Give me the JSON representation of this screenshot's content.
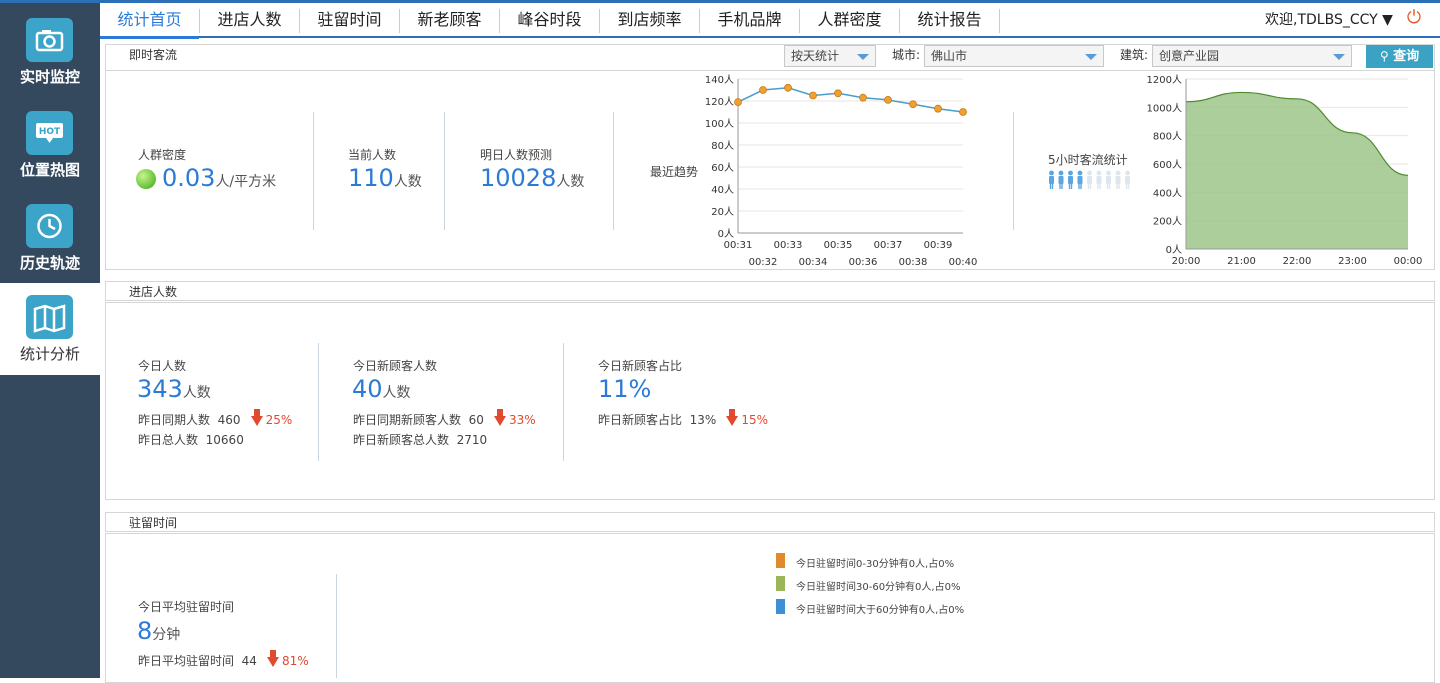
{
  "sidebar": {
    "items": [
      {
        "label": "实时监控"
      },
      {
        "label": "位置热图",
        "icon_text": "HOT"
      },
      {
        "label": "历史轨迹"
      },
      {
        "label": "统计分析"
      }
    ]
  },
  "tabs": [
    "统计首页",
    "进店人数",
    "驻留时间",
    "新老顾客",
    "峰谷时段",
    "到店频率",
    "手机品牌",
    "人群密度",
    "统计报告"
  ],
  "header": {
    "welcome": "欢迎,TDLBS_CCY ▼"
  },
  "instant": {
    "title": "即时客流",
    "stat_mode": "按天统计",
    "city_label": "城市:",
    "city": "佛山市",
    "building_label": "建筑:",
    "building": "创意产业园",
    "query": "查询",
    "density_label": "人群密度",
    "density_value": "0.03",
    "density_unit": "人/平方米",
    "current_label": "当前人数",
    "current_value": "110",
    "current_unit": "人数",
    "forecast_label": "明日人数预测",
    "forecast_value": "10028",
    "forecast_unit": "人数",
    "trend_label": "最近趋势",
    "five_hour_label": "5小时客流统计"
  },
  "store": {
    "title": "进店人数",
    "today_label": "今日人数",
    "today_value": "343",
    "today_unit": "人数",
    "yday_same_label": "昨日同期人数",
    "yday_same_value": "460",
    "yday_same_pct": "25%",
    "yday_total_label": "昨日总人数",
    "yday_total_value": "10660",
    "new_label": "今日新顾客人数",
    "new_value": "40",
    "new_unit": "人数",
    "yday_new_same_label": "昨日同期新顾客人数",
    "yday_new_same_value": "60",
    "yday_new_same_pct": "33%",
    "yday_new_total_label": "昨日新顾客总人数",
    "yday_new_total_value": "2710",
    "ratio_label": "今日新顾客占比",
    "ratio_value": "11%",
    "yday_ratio_label": "昨日新顾客占比",
    "yday_ratio_value": "13%",
    "yday_ratio_pct": "15%"
  },
  "dwell": {
    "title": "驻留时间",
    "avg_label": "今日平均驻留时间",
    "avg_value": "8",
    "avg_unit": "分钟",
    "yday_label": "昨日平均驻留时间",
    "yday_value": "44",
    "yday_pct": "81%",
    "legend": [
      {
        "text": "今日驻留时间0-30分钟有0人,占0%",
        "color": "#e08a2c"
      },
      {
        "text": "今日驻留时间30-60分钟有0人,占0%",
        "color": "#9bb55a"
      },
      {
        "text": "今日驻留时间大于60分钟有0人,占0%",
        "color": "#3d8fd6"
      }
    ]
  },
  "chart_data": [
    {
      "type": "line",
      "x": [
        "00:31",
        "00:32",
        "00:33",
        "00:34",
        "00:35",
        "00:36",
        "00:37",
        "00:38",
        "00:39",
        "00:40"
      ],
      "values": [
        119,
        130,
        132,
        125,
        127,
        123,
        121,
        117,
        113,
        110
      ],
      "ylim": [
        0,
        140
      ],
      "yticks": [
        "0人",
        "20人",
        "40人",
        "60人",
        "80人",
        "100人",
        "120人",
        "140人"
      ],
      "color": "#4a9cc9",
      "marker_color": "#f0a030"
    },
    {
      "type": "area",
      "x": [
        "20:00",
        "21:00",
        "22:00",
        "23:00",
        "00:00"
      ],
      "values": [
        1040,
        1105,
        1060,
        820,
        520
      ],
      "ylim": [
        0,
        1200
      ],
      "yticks": [
        "0人",
        "200人",
        "400人",
        "600人",
        "800人",
        "1000人",
        "1200人"
      ],
      "color": "#9cc68a",
      "line_color": "#4f8a2f"
    }
  ]
}
